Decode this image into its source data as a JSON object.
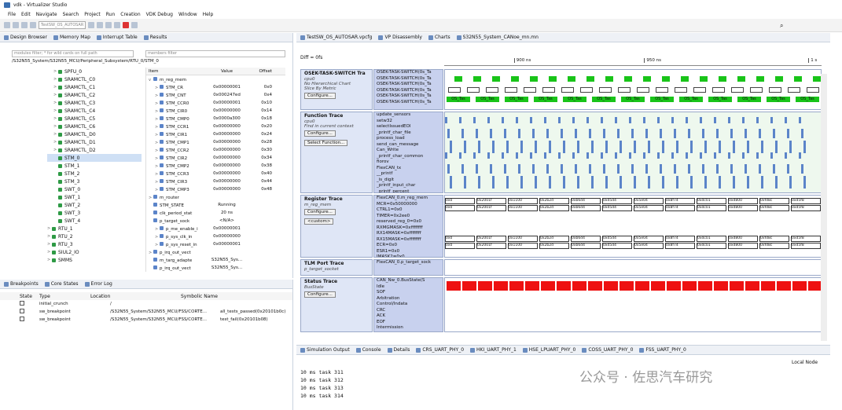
{
  "window": {
    "title": "vdk - Virtualizer Studio"
  },
  "menu": [
    "File",
    "Edit",
    "Navigate",
    "Search",
    "Project",
    "Run",
    "Creation",
    "VDK Debug",
    "Window",
    "Help"
  ],
  "toolbar": {
    "target_select": "TestSW_OS_AUTOSAR"
  },
  "left_tabs": [
    {
      "label": "Design Browser"
    },
    {
      "label": "Memory Map"
    },
    {
      "label": "Interrupt Table"
    },
    {
      "label": "Results"
    }
  ],
  "design_browser": {
    "filter_placeholder": "modules filter; * for wild cards on full path",
    "members_placeholder": "members filter",
    "path": "/S32N55_System/S32N55_MCU/Peripheral_Subsystem/RTU_0/STM_0",
    "tree": [
      {
        "label": "SPFU_0",
        "indent": 2,
        "arrow": ">"
      },
      {
        "label": "SRAMCTL_C0",
        "indent": 2,
        "arrow": ">"
      },
      {
        "label": "SRAMCTL_C1",
        "indent": 2,
        "arrow": ">"
      },
      {
        "label": "SRAMCTL_C2",
        "indent": 2,
        "arrow": ">"
      },
      {
        "label": "SRAMCTL_C3",
        "indent": 2,
        "arrow": ">"
      },
      {
        "label": "SRAMCTL_C4",
        "indent": 2,
        "arrow": ">"
      },
      {
        "label": "SRAMCTL_C5",
        "indent": 2,
        "arrow": ">"
      },
      {
        "label": "SRAMCTL_C6",
        "indent": 2,
        "arrow": ">"
      },
      {
        "label": "SRAMCTL_D0",
        "indent": 2,
        "arrow": ">"
      },
      {
        "label": "SRAMCTL_D1",
        "indent": 2,
        "arrow": ">"
      },
      {
        "label": "SRAMCTL_D2",
        "indent": 2,
        "arrow": ">"
      },
      {
        "label": "STM_0",
        "indent": 2,
        "arrow": "",
        "selected": true
      },
      {
        "label": "STM_1",
        "indent": 2,
        "arrow": ""
      },
      {
        "label": "STM_2",
        "indent": 2,
        "arrow": ""
      },
      {
        "label": "STM_3",
        "indent": 2,
        "arrow": ""
      },
      {
        "label": "SWT_0",
        "indent": 2,
        "arrow": ""
      },
      {
        "label": "SWT_1",
        "indent": 2,
        "arrow": ""
      },
      {
        "label": "SWT_2",
        "indent": 2,
        "arrow": ""
      },
      {
        "label": "SWT_3",
        "indent": 2,
        "arrow": ""
      },
      {
        "label": "SWT_4",
        "indent": 2,
        "arrow": ""
      },
      {
        "label": "RTU_1",
        "indent": 1,
        "arrow": ">"
      },
      {
        "label": "RTU_2",
        "indent": 1,
        "arrow": ">"
      },
      {
        "label": "RTU_3",
        "indent": 1,
        "arrow": ">"
      },
      {
        "label": "SIUL2_IO",
        "indent": 1,
        "arrow": ">"
      },
      {
        "label": "SMMS",
        "indent": 1,
        "arrow": ">"
      }
    ],
    "members_header": {
      "item": "Item",
      "value": "Value",
      "offset": "Offset"
    },
    "members": [
      {
        "item": "m_reg_mem",
        "value": "",
        "offset": "",
        "indent": 0,
        "arrow": "v"
      },
      {
        "item": "STM_CR",
        "value": "0x00000001",
        "offset": "0x0",
        "indent": 1,
        "arrow": ">"
      },
      {
        "item": "STM_CNT",
        "value": "0x000247ed",
        "offset": "0x4",
        "indent": 1,
        "arrow": ">"
      },
      {
        "item": "STM_CCR0",
        "value": "0x00000001",
        "offset": "0x10",
        "indent": 1,
        "arrow": ">"
      },
      {
        "item": "STM_CIR0",
        "value": "0x00000000",
        "offset": "0x14",
        "indent": 1,
        "arrow": ">"
      },
      {
        "item": "STM_CMP0",
        "value": "0x0000a300",
        "offset": "0x18",
        "indent": 1,
        "arrow": ">"
      },
      {
        "item": "STM_CCR1",
        "value": "0x00000000",
        "offset": "0x20",
        "indent": 1,
        "arrow": ">"
      },
      {
        "item": "STM_CIR1",
        "value": "0x00000000",
        "offset": "0x24",
        "indent": 1,
        "arrow": ">"
      },
      {
        "item": "STM_CMP1",
        "value": "0x00000000",
        "offset": "0x28",
        "indent": 1,
        "arrow": ">"
      },
      {
        "item": "STM_CCR2",
        "value": "0x00000000",
        "offset": "0x30",
        "indent": 1,
        "arrow": ">"
      },
      {
        "item": "STM_CIR2",
        "value": "0x00000000",
        "offset": "0x34",
        "indent": 1,
        "arrow": ">"
      },
      {
        "item": "STM_CMP2",
        "value": "0x00000000",
        "offset": "0x38",
        "indent": 1,
        "arrow": ">"
      },
      {
        "item": "STM_CCR3",
        "value": "0x00000000",
        "offset": "0x40",
        "indent": 1,
        "arrow": ">"
      },
      {
        "item": "STM_CIR3",
        "value": "0x00000000",
        "offset": "0x44",
        "indent": 1,
        "arrow": ">"
      },
      {
        "item": "STM_CMP3",
        "value": "0x00000000",
        "offset": "0x48",
        "indent": 1,
        "arrow": ">"
      },
      {
        "item": "m_router",
        "value": "",
        "offset": "",
        "indent": 0,
        "arrow": ">"
      },
      {
        "item": "STM_STATE",
        "value": "Running",
        "offset": "",
        "indent": 0,
        "arrow": ""
      },
      {
        "item": "clk_period_stat",
        "value": "20 ns",
        "offset": "",
        "indent": 0,
        "arrow": ""
      },
      {
        "item": "p_target_sock",
        "value": "<N/A>",
        "offset": "",
        "indent": 0,
        "arrow": ""
      },
      {
        "item": "p_me_enable_i",
        "value": "0x00000001",
        "offset": "",
        "indent": 1,
        "arrow": ">"
      },
      {
        "item": "p_sys_clk_in",
        "value": "0x00000000",
        "offset": "",
        "indent": 1,
        "arrow": ">"
      },
      {
        "item": "p_sys_reset_in",
        "value": "0x00000001",
        "offset": "",
        "indent": 1,
        "arrow": ">"
      },
      {
        "item": "p_irq_out_vect",
        "value": "",
        "offset": "",
        "indent": 0,
        "arrow": ">"
      },
      {
        "item": "m_targ_adapte",
        "value": "S32N55_Sys...",
        "offset": "",
        "indent": 0,
        "arrow": ""
      },
      {
        "item": "p_irq_out_vect",
        "value": "S32N55_Sys...",
        "offset": "",
        "indent": 0,
        "arrow": ""
      }
    ]
  },
  "bottom_left_tabs": [
    {
      "label": "Breakpoints"
    },
    {
      "label": "Core States"
    },
    {
      "label": "Error Log"
    }
  ],
  "breakpoints": {
    "headers": {
      "state": "State",
      "type": "Type",
      "location": "Location",
      "symbolic": "Symbolic Name"
    },
    "rows": [
      {
        "type": "initial_crunch",
        "location": "/",
        "symbolic": ""
      },
      {
        "type": "sw_breakpoint",
        "location": "/S32N55_System/S32N55_MCU/FSS/CORTE...",
        "symbolic": "all_tests_passed(0x20101b0c)"
      },
      {
        "type": "sw_breakpoint",
        "location": "/S32N55_System/S32N55_MCU/FSS/CORTE...",
        "symbolic": "test_fail(0x20101b08)"
      }
    ]
  },
  "editor_tabs": [
    {
      "label": "TestSW_OS_AUTOSAR.vpcfg"
    },
    {
      "label": "VP Disassembly"
    },
    {
      "label": "Charts"
    },
    {
      "label": "S32N55_System_CANoe_mn.mn"
    }
  ],
  "chart": {
    "diff_label": "Diff = 0fs",
    "time_ticks": [
      {
        "label": "900 ns",
        "pos": 0.185
      },
      {
        "label": "950 ns",
        "pos": 0.53
      },
      {
        "label": "1 s",
        "pos": 0.965
      }
    ],
    "lanes": [
      {
        "title": "OSEK-TASK-SWITCH Tra",
        "sub": "cpu0",
        "lines": [
          "No Hierarchical Chart",
          "Slice By Metric"
        ],
        "buttons": [
          "Configure..."
        ],
        "signals": [
          "OSEK-TASK-SWITCH(0s_Ta",
          "OSEK-TASK-SWITCH(0s_Ta",
          "OSEK-TASK-SWITCH(0s_Ta",
          "OSEK-TASK-SWITCH(0s_Ta",
          "OSEK-TASK-SWITCH(0s_Ta",
          "OSEK-TASK-SWITCH(0s_Ta"
        ],
        "box_label": "OS_Tas"
      },
      {
        "title": "Function Trace",
        "sub": "cpu0",
        "lines": [
          "",
          "Find in current context"
        ],
        "buttons": [
          "Configure...",
          "Select Function..."
        ],
        "signals": [
          "update_sensors",
          "setw32",
          "selectIssuedEOI",
          "_printf_char_file",
          "process_load",
          "send_can_message",
          "Can_Write",
          "_printf_char_common",
          "fiorov",
          "FlexCAN_tx",
          "__printf",
          "_is_digit",
          "_printf_input_char",
          "_printf_percent"
        ]
      },
      {
        "title": "Register Trace",
        "sub": "m_reg_mem",
        "lines": [],
        "buttons": [
          "Configure...",
          "<custom>"
        ],
        "signals": [
          "FlexCAN_0.m_reg_mem",
          "MCR=0x50000000",
          "CTRL1=0x0",
          "TIMER=0x2ee0",
          "reserved_reg_0=0x0",
          "RXMGMASK=0xffffffff",
          "RX14MASK=0xffffffff",
          "RX15MASK=0xffffffff",
          "ECR=0x0",
          "ESR1=0x0",
          "IMASK2=0x0"
        ],
        "values": [
          "0x0",
          "0x2001f",
          "0x1100",
          "0x2b2d",
          "0xb6d4",
          "0xd5d4",
          "0x5e04",
          "0x8f74",
          "0xdc01",
          "0xd800",
          "0xfd8c",
          "0xd5f8"
        ]
      },
      {
        "title": "TLM Port Trace",
        "sub": "p_target_socket",
        "lines": [],
        "buttons": [],
        "signals": [
          "FlexCAN_0.p_target_sock"
        ]
      },
      {
        "title": "Status Trace",
        "sub": "BusState",
        "lines": [],
        "buttons": [
          "Configure..."
        ],
        "signals": [
          "CAN_Nw_0.BusState(S",
          "Idle",
          "SOF",
          "Arbitration",
          "Control/Indata",
          "CRC",
          "ACK",
          "EOF",
          "Intermission"
        ]
      }
    ]
  },
  "bottom_tabs": [
    {
      "label": "Simulation Output"
    },
    {
      "label": "Console"
    },
    {
      "label": "Details"
    },
    {
      "label": "CRS_UART_PHY_0"
    },
    {
      "label": "HKI_UART_PHY_1"
    },
    {
      "label": "HSE_LPUART_PHY_0"
    },
    {
      "label": "COSS_UART_PHY_0"
    },
    {
      "label": "FSS_UART_PHY_0"
    }
  ],
  "console": {
    "lines": [
      "10 ms task 311",
      "10 ms task 312",
      "10 ms task 313",
      "10 ms task 314"
    ],
    "local_node": "Local Node"
  },
  "watermark": "公众号 · 佐思汽车研究",
  "colors": {
    "accent": "#3a6fb0",
    "lane_bg": "#dfe6f6",
    "signal_bg": "#c8d1ee",
    "task_green": "#19c419",
    "status_red": "#e11",
    "func_blue": "#5b84c9",
    "fn_bg": "#eef8ee"
  }
}
